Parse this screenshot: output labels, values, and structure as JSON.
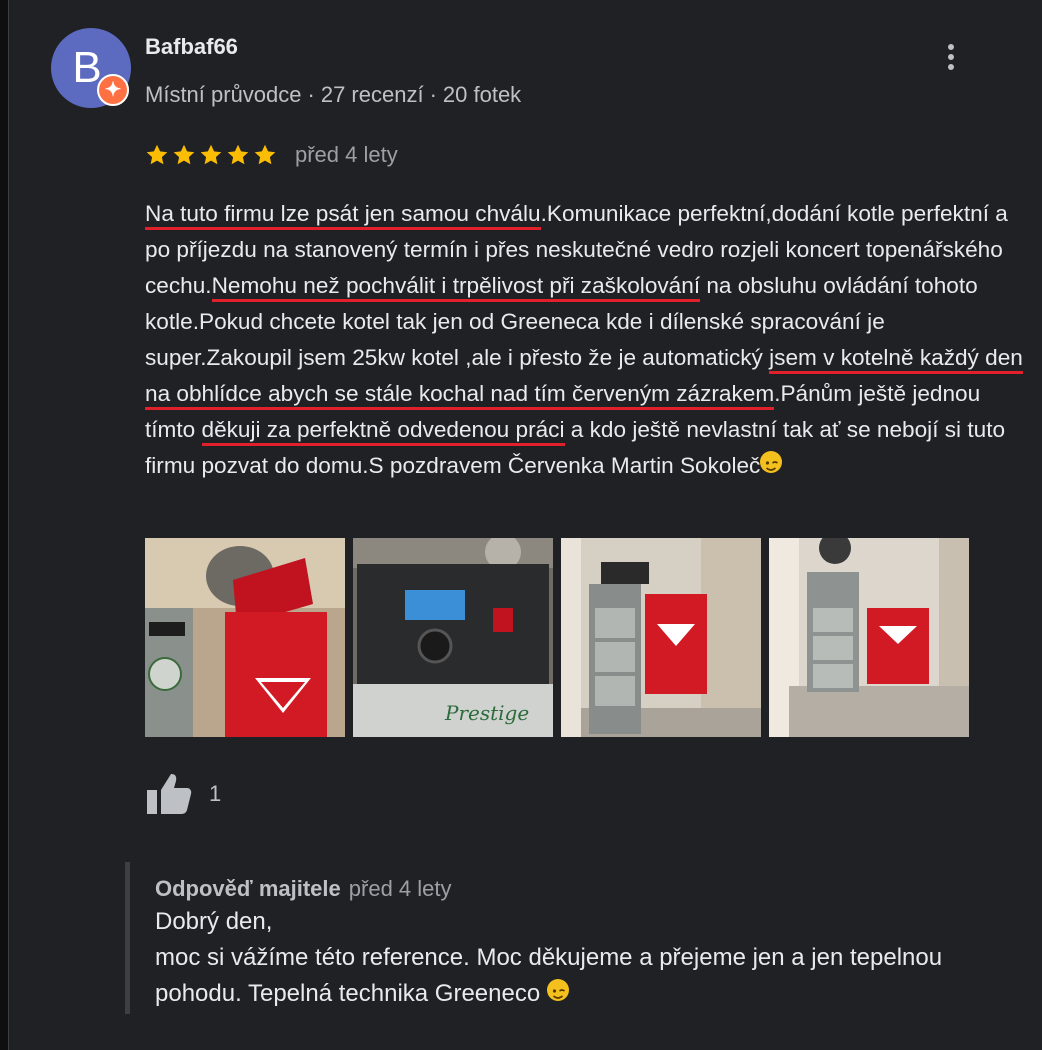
{
  "review": {
    "author": {
      "initial": "B",
      "name": "Bafbaf66",
      "badge": "Místní průvodce",
      "reviews": "27 recenzí",
      "photos": "20 fotek"
    },
    "rating": 5,
    "time": "před 4 lety",
    "text": {
      "p1": "Na tuto firmu lze psát jen samou chválu",
      "p2": ".Komunikace perfektní,dodání kotle perfektní a po příjezdu na stanovený termín i přes neskutečné vedro rozjeli koncert topenářského cechu.",
      "p3": "Nemohu než pochválit i trpělivost při zaškolování",
      "p4": " na obsluhu ovládání tohoto kotle.Pokud chcete kotel tak jen od Greeneca kde i dílenské spracování je super.Zakoupil jsem 25kw kotel ,ale i přesto že je automatický ",
      "p5": "jsem v kotelně každý den na obhlídce abych se stále kochal nad tím červeným zázrakem",
      "p6": ".Pánům ještě jednou  tímto ",
      "p7": "děkuji za perfektně odvedenou práci",
      "p8": " a kdo ještě nevlastní tak ať se nebojí si tuto firmu pozvat do domu.S pozdravem Červenka Martin Sokoleč"
    },
    "photo_print": "Prestige",
    "likes": "1"
  },
  "owner_reply": {
    "label": "Odpověď majitele",
    "time": "před 4 lety",
    "line1": "Dobrý den,",
    "line2": "moc si vážíme této reference. Moc děkujeme a přejeme jen a jen tepelnou pohodu. Tepelná technika Greeneco"
  },
  "icons": {
    "more": "more-vert-icon",
    "star": "star-icon",
    "like": "thumb-up-icon",
    "badge": "local-guide-icon",
    "emoji": "wink-emoji"
  },
  "colors": {
    "background": "#202124",
    "star": "#fbbc04",
    "underline": "#e0202a",
    "avatar": "#5c6bc0",
    "badge": "#ff7043"
  }
}
